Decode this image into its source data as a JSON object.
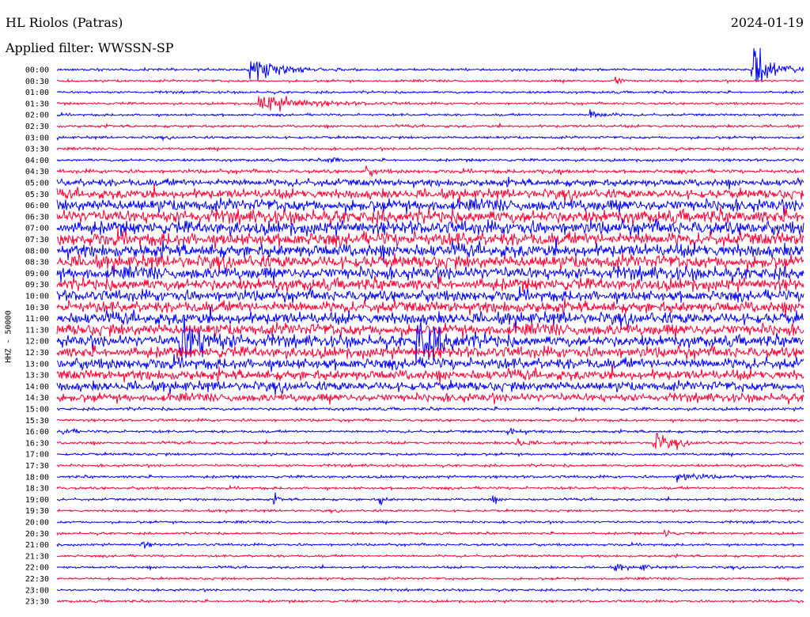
{
  "chart_data": {
    "type": "line",
    "title": "HL Riolos (Patras)",
    "subtitle": "Applied filter: WWSSN-SP",
    "date": "2024-01-19",
    "ylabel": "HHZ - 50000",
    "row_labels": [
      "00:00",
      "00:30",
      "01:00",
      "01:30",
      "02:00",
      "02:30",
      "03:00",
      "03:30",
      "04:00",
      "04:30",
      "05:00",
      "05:30",
      "06:00",
      "06:30",
      "07:00",
      "07:30",
      "08:00",
      "08:30",
      "09:00",
      "09:30",
      "10:00",
      "10:30",
      "11:00",
      "11:30",
      "12:00",
      "12:30",
      "13:00",
      "13:30",
      "14:00",
      "14:30",
      "15:00",
      "15:30",
      "16:00",
      "16:30",
      "17:00",
      "17:30",
      "18:00",
      "18:30",
      "19:00",
      "19:30",
      "20:00",
      "20:30",
      "21:00",
      "21:30",
      "22:00",
      "22:30",
      "23:00",
      "23:30"
    ],
    "series_colors": [
      "#0000ff",
      "#ff0033"
    ],
    "noise_level": [
      0.1,
      0.1,
      0.1,
      0.1,
      0.1,
      0.12,
      0.12,
      0.12,
      0.12,
      0.2,
      0.5,
      0.7,
      0.9,
      1.0,
      1.0,
      1.0,
      1.0,
      1.0,
      0.95,
      0.9,
      0.8,
      0.85,
      0.9,
      0.9,
      0.85,
      0.8,
      0.8,
      0.75,
      0.7,
      0.6,
      0.15,
      0.12,
      0.12,
      0.12,
      0.12,
      0.12,
      0.12,
      0.12,
      0.1,
      0.1,
      0.1,
      0.1,
      0.1,
      0.1,
      0.1,
      0.1,
      0.1,
      0.1
    ],
    "events": [
      {
        "row": 0,
        "minute": 7.8,
        "amplitude": 20,
        "duration_min": 1.5
      },
      {
        "row": 1,
        "minute": 22.5,
        "amplitude": 6,
        "duration_min": 0.3
      },
      {
        "row": 3,
        "minute": 8.2,
        "amplitude": 12,
        "duration_min": 2.5
      },
      {
        "row": 4,
        "minute": 21.5,
        "amplitude": 5,
        "duration_min": 0.8
      },
      {
        "row": 0,
        "minute": 28.0,
        "amplitude": 26,
        "duration_min": 1.2
      },
      {
        "row": 8,
        "minute": 11.0,
        "amplitude": 5,
        "duration_min": 0.6
      },
      {
        "row": 9,
        "minute": 12.5,
        "amplitude": 5,
        "duration_min": 0.5
      },
      {
        "row": 9,
        "minute": 19.6,
        "amplitude": 5,
        "duration_min": 0.6
      },
      {
        "row": 24,
        "minute": 5.0,
        "amplitude": 30,
        "duration_min": 1.5
      },
      {
        "row": 24,
        "minute": 14.5,
        "amplitude": 28,
        "duration_min": 1.5
      },
      {
        "row": 32,
        "minute": 0.3,
        "amplitude": 5,
        "duration_min": 0.5
      },
      {
        "row": 32,
        "minute": 18.2,
        "amplitude": 5,
        "duration_min": 0.6
      },
      {
        "row": 33,
        "minute": 18.5,
        "amplitude": 6,
        "duration_min": 0.6
      },
      {
        "row": 33,
        "minute": 24.0,
        "amplitude": 12,
        "duration_min": 1.0
      },
      {
        "row": 36,
        "minute": 25.0,
        "amplitude": 6,
        "duration_min": 1.2
      },
      {
        "row": 38,
        "minute": 8.8,
        "amplitude": 4,
        "duration_min": 0.3
      },
      {
        "row": 38,
        "minute": 13.0,
        "amplitude": 5,
        "duration_min": 0.3
      },
      {
        "row": 38,
        "minute": 17.5,
        "amplitude": 4,
        "duration_min": 0.3
      },
      {
        "row": 41,
        "minute": 24.5,
        "amplitude": 4,
        "duration_min": 0.4
      },
      {
        "row": 42,
        "minute": 3.5,
        "amplitude": 4,
        "duration_min": 0.4
      },
      {
        "row": 44,
        "minute": 22.5,
        "amplitude": 4,
        "duration_min": 0.4
      },
      {
        "row": 44,
        "minute": 23.5,
        "amplitude": 4,
        "duration_min": 0.4
      }
    ]
  }
}
